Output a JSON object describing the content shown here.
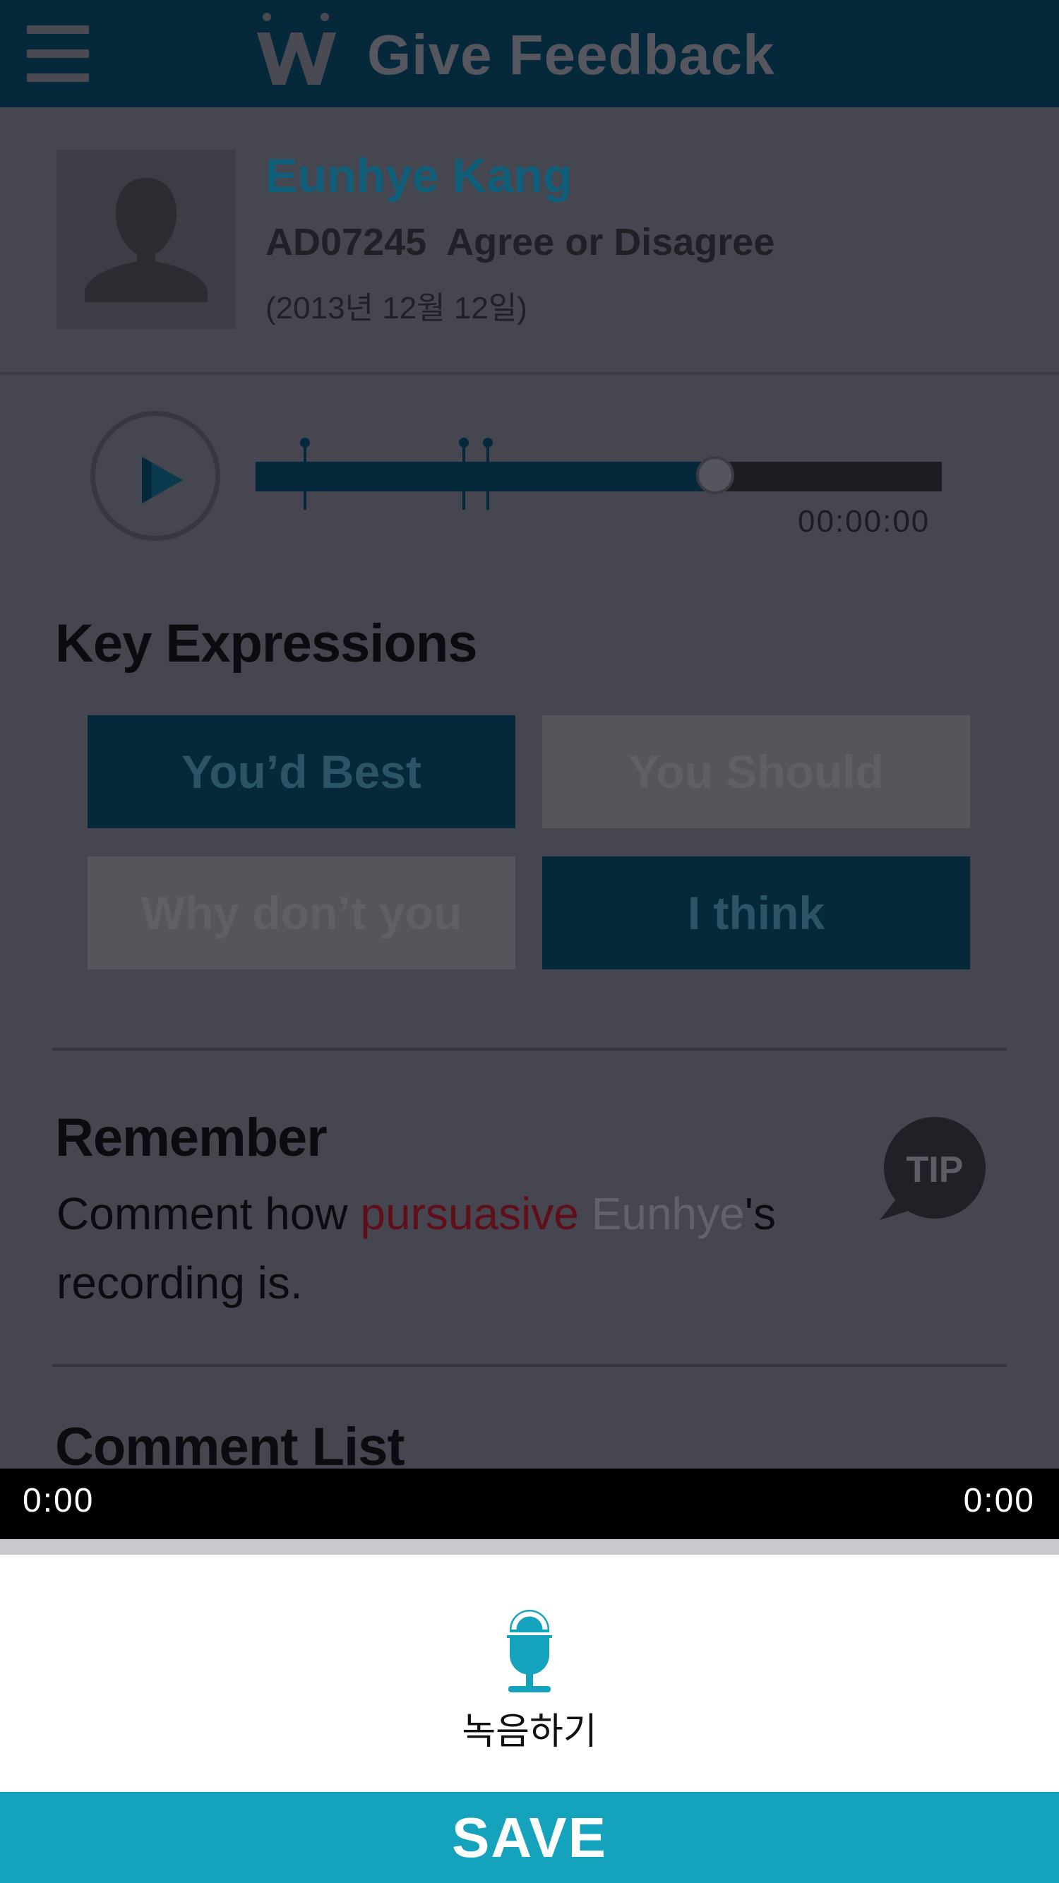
{
  "header": {
    "title": "Give Feedback",
    "menu_icon": "hamburger-menu-icon",
    "logo_icon": "w-logo-icon"
  },
  "profile": {
    "name": "Eunhye Kang",
    "assignment": "AD07245  Agree or Disagree",
    "date": "(2013년 12월 12일)",
    "avatar_icon": "person-silhouette-icon"
  },
  "player": {
    "time": "00:00:00",
    "progress": 0.67,
    "play_icon": "play-icon"
  },
  "key_expressions": {
    "title": "Key Expressions",
    "items": [
      {
        "label": "You’d Best",
        "selected": true
      },
      {
        "label": "You Should",
        "selected": false
      },
      {
        "label": "Why don’t you",
        "selected": false
      },
      {
        "label": "I think",
        "selected": true
      }
    ]
  },
  "remember": {
    "title": "Remember",
    "text_prefix": "Comment how ",
    "text_highlight": "pursuasive",
    "text_name": "Eunhye",
    "text_suffix": "'s recording is.",
    "tip_label": "TIP"
  },
  "comment_list": {
    "title": "Comment List"
  },
  "media_bar": {
    "current_time": "0:00",
    "total_time": "0:00"
  },
  "recorder": {
    "label": "녹음하기",
    "mic_icon": "microphone-icon"
  },
  "save_button": {
    "label": "SAVE"
  },
  "colors": {
    "accent": "#14a2bd",
    "header_bg": "#05293a",
    "highlight_red": "#5e0f19"
  }
}
